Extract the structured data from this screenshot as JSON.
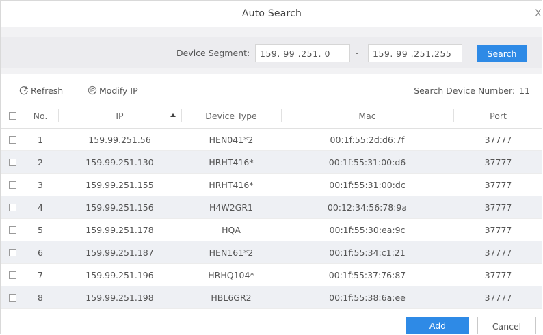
{
  "dialog": {
    "title": "Auto Search",
    "close_glyph": "X"
  },
  "segment": {
    "label": "Device Segment:",
    "start": "159. 99 .251. 0",
    "dash": "-",
    "end": "159. 99 .251.255",
    "search_label": "Search"
  },
  "toolbar": {
    "refresh_label": "Refresh",
    "modify_label": "Modify IP",
    "count_label": "Search Device Number:",
    "count_value": "11"
  },
  "table": {
    "headers": {
      "no": "No.",
      "ip": "IP",
      "type": "Device Type",
      "mac": "Mac",
      "port": "Port"
    },
    "rows": [
      {
        "no": "1",
        "ip": "159.99.251.56",
        "type": "HEN041*2",
        "mac": "00:1f:55:2d:d6:7f",
        "port": "37777"
      },
      {
        "no": "2",
        "ip": "159.99.251.130",
        "type": "HRHT416*",
        "mac": "00:1f:55:31:00:d6",
        "port": "37777"
      },
      {
        "no": "3",
        "ip": "159.99.251.155",
        "type": "HRHT416*",
        "mac": "00:1f:55:31:00:dc",
        "port": "37777"
      },
      {
        "no": "4",
        "ip": "159.99.251.156",
        "type": "H4W2GR1",
        "mac": "00:12:34:56:78:9a",
        "port": "37777"
      },
      {
        "no": "5",
        "ip": "159.99.251.178",
        "type": "HQA",
        "mac": "00:1f:55:30:ea:9c",
        "port": "37777"
      },
      {
        "no": "6",
        "ip": "159.99.251.187",
        "type": "HEN161*2",
        "mac": "00:1f:55:34:c1:21",
        "port": "37777"
      },
      {
        "no": "7",
        "ip": "159.99.251.196",
        "type": "HRHQ104*",
        "mac": "00:1f:55:37:76:87",
        "port": "37777"
      },
      {
        "no": "8",
        "ip": "159.99.251.198",
        "type": "HBL6GR2",
        "mac": "00:1f:55:38:6a:ee",
        "port": "37777"
      }
    ]
  },
  "footer": {
    "add_label": "Add",
    "cancel_label": "Cancel"
  },
  "colors": {
    "accent": "#2e8ae6",
    "row_alt": "#eef0f4",
    "band": "#ececef"
  }
}
